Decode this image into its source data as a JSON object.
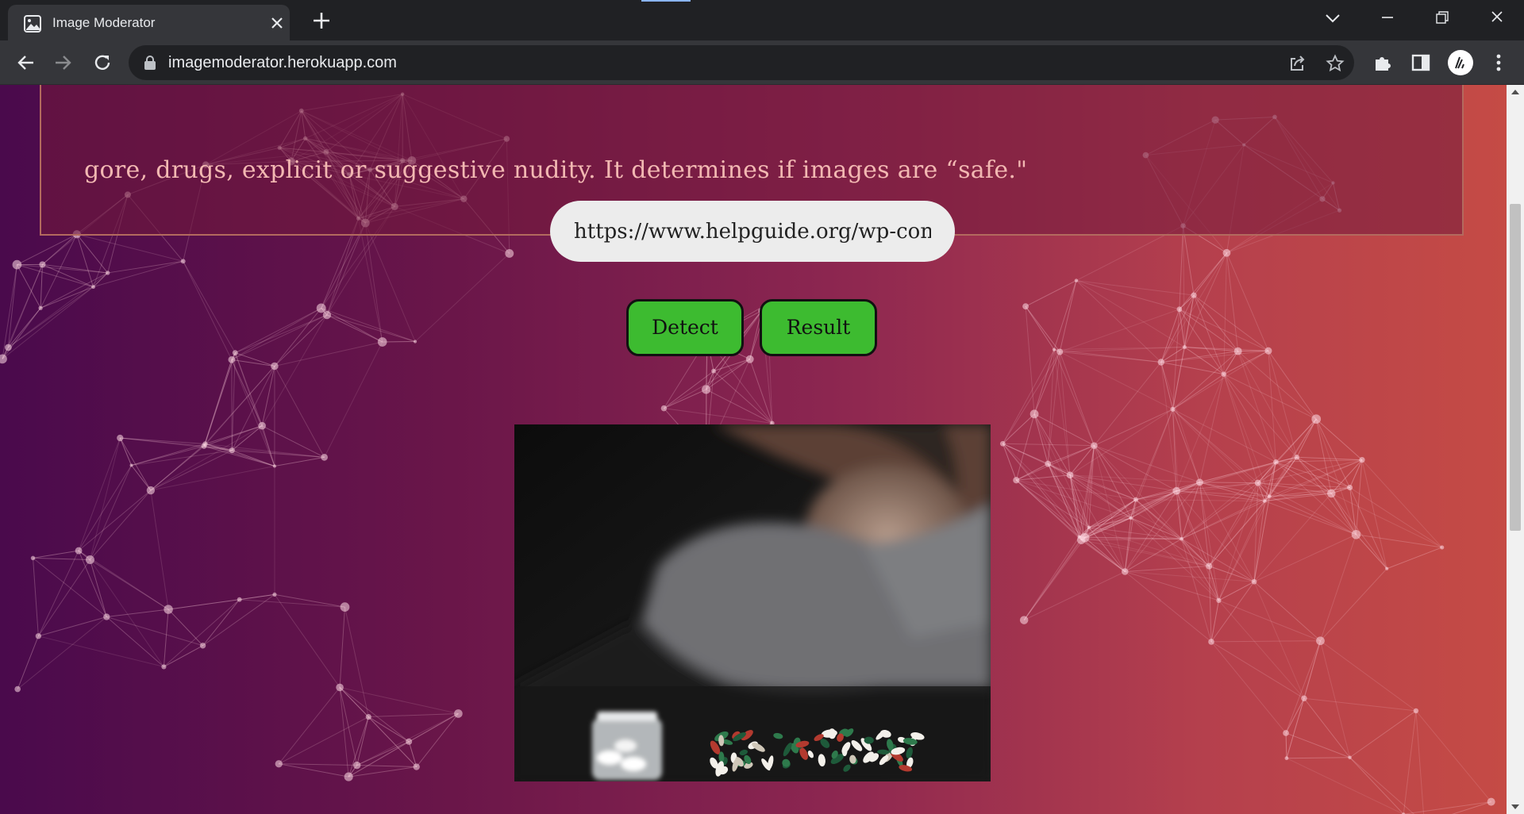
{
  "browser": {
    "tab": {
      "title": "Image Moderator",
      "favicon": "image-icon"
    },
    "url": "imagemoderator.herokuapp.com",
    "icons": [
      "back-arrow-icon",
      "forward-arrow-icon",
      "reload-icon",
      "lock-icon",
      "share-icon",
      "star-icon",
      "puzzle-icon",
      "sidepanel-icon",
      "kebab-menu-icon"
    ]
  },
  "page": {
    "description_line": "gore, drugs, explicit or suggestive nudity. It determines if images are “safe.\"",
    "image_url_value": "https://www.helpguide.org/wp-content",
    "buttons": {
      "detect": "Detect",
      "result": "Result"
    },
    "image_alt": "Person resting head on arm behind spilled pills and pill bottle",
    "colors": {
      "button": "#3dbb30",
      "gradient_start": "#4a0a4c",
      "gradient_end": "#c54b45",
      "description_text": "#f2b8b2"
    }
  }
}
